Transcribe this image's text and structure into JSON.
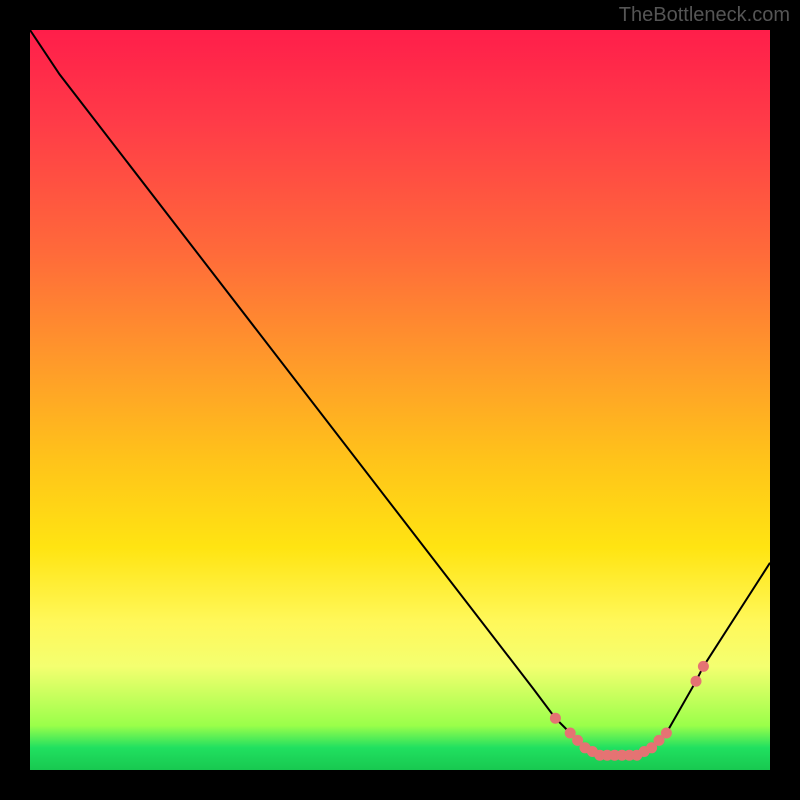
{
  "attribution": "TheBottleneck.com",
  "chart_data": {
    "type": "line",
    "title": "",
    "xlabel": "",
    "ylabel": "",
    "xlim": [
      0,
      100
    ],
    "ylim": [
      0,
      100
    ],
    "series": [
      {
        "name": "bottleneck-curve",
        "x": [
          0,
          4,
          68,
          71,
          73,
          74,
          75,
          76,
          77,
          78,
          79,
          80,
          81,
          82,
          83,
          84,
          85,
          86,
          90,
          91,
          100
        ],
        "y": [
          100,
          94,
          11,
          7,
          5,
          4,
          3,
          2.5,
          2,
          2,
          2,
          2,
          2,
          2,
          2.5,
          3,
          4,
          5,
          12,
          14,
          28
        ]
      }
    ],
    "markers": {
      "name": "highlight-points",
      "color": "#e57373",
      "x": [
        71,
        73,
        74,
        75,
        76,
        77,
        78,
        79,
        80,
        81,
        82,
        83,
        84,
        85,
        86,
        90,
        91
      ],
      "y": [
        7,
        5,
        4,
        3,
        2.5,
        2,
        2,
        2,
        2,
        2,
        2,
        2.5,
        3,
        4,
        5,
        12,
        14
      ]
    }
  }
}
